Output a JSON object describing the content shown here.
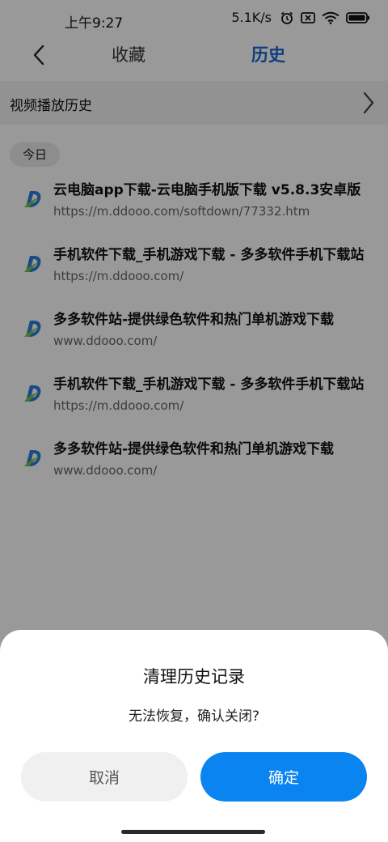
{
  "status_bar": {
    "time": "上午9:27",
    "net_speed": "5.1K/s",
    "icons": [
      "alarm-icon",
      "sim-no-icon",
      "wifi-icon",
      "battery-icon"
    ]
  },
  "nav": {
    "back_icon": "chevron-left-icon",
    "tab_favorites": "收藏",
    "tab_history": "历史",
    "active_tab": "历史",
    "accent_color": "#1a67d6"
  },
  "video_history": {
    "label": "视频播放历史",
    "icon": "chevron-right-icon"
  },
  "section": {
    "today_label": "今日"
  },
  "history_items": [
    {
      "title": "云电脑app下载-云电脑手机版下载 v5.8.3安卓版",
      "url": "https://m.ddooo.com/softdown/77332.htm"
    },
    {
      "title": "手机软件下载_手机游戏下载 - 多多软件手机下载站",
      "url": "https://m.ddooo.com/"
    },
    {
      "title": "多多软件站-提供绿色软件和热门单机游戏下载",
      "url": "www.ddooo.com/"
    },
    {
      "title": "手机软件下载_手机游戏下载 - 多多软件手机下载站",
      "url": "https://m.ddooo.com/"
    },
    {
      "title": "多多软件站-提供绿色软件和热门单机游戏下载",
      "url": "www.ddooo.com/"
    }
  ],
  "dialog": {
    "title": "清理历史记录",
    "message": "无法恢复，确认关闭?",
    "cancel_label": "取消",
    "confirm_label": "确定",
    "confirm_color": "#0a84f0"
  }
}
